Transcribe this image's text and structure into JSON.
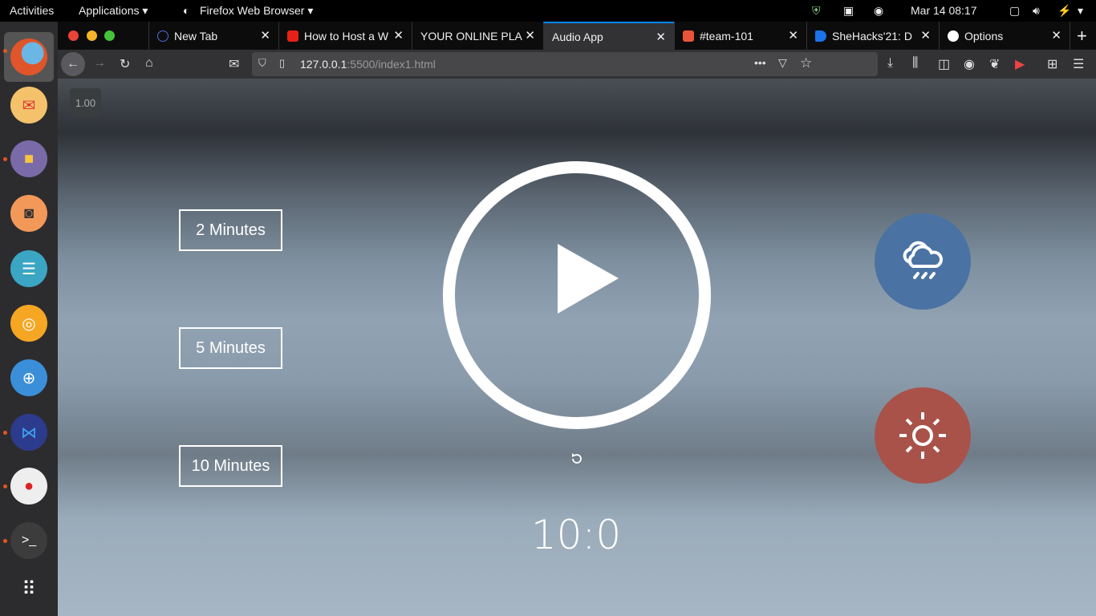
{
  "topbar": {
    "activities": "Activities",
    "applications": "Applications ▾",
    "app_name": "Firefox Web Browser ▾",
    "datetime": "Mar 14  08:17"
  },
  "dock": {
    "items": [
      "firefox",
      "mail",
      "files",
      "speaker",
      "text-editor",
      "software-center",
      "help",
      "vscode",
      "screenshot",
      "terminal",
      "apps-grid"
    ]
  },
  "tabs": [
    {
      "label": "New Tab",
      "icon": "firefox-newtab-icon",
      "color": "#4a6fd4"
    },
    {
      "label": "How to Host a W",
      "icon": "youtube-icon",
      "color": "#e62117"
    },
    {
      "label": "YOUR ONLINE PLA",
      "icon": "",
      "color": ""
    },
    {
      "label": "Audio App",
      "icon": "",
      "color": "",
      "active": true
    },
    {
      "label": "#team-101",
      "icon": "calendar-icon",
      "color": "#e8543a"
    },
    {
      "label": "SheHacks'21: D",
      "icon": "doc-icon",
      "color": "#1a73e8"
    },
    {
      "label": "Options",
      "icon": "github-icon",
      "color": "#ffffff"
    }
  ],
  "toolbar": {
    "url_host": "127.0.0.1",
    "url_rest": ":5500/index1.html"
  },
  "app": {
    "speed": "1.00",
    "durations": [
      "2 Minutes",
      "5 Minutes",
      "10 Minutes"
    ],
    "timer": "10:0",
    "rain_color": "#4a72a3",
    "sun_color": "#a8524a"
  }
}
